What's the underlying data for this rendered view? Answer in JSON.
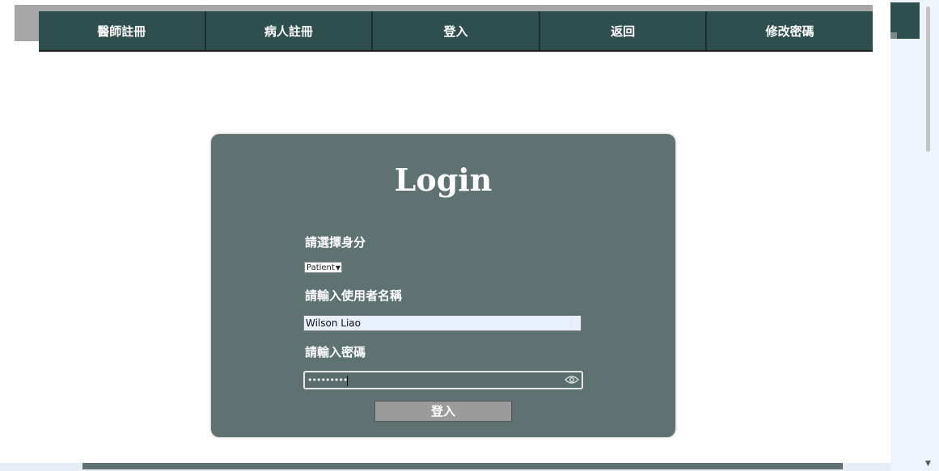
{
  "nav": {
    "items": [
      {
        "label": "醫師註冊"
      },
      {
        "label": "病人註冊"
      },
      {
        "label": "登入"
      },
      {
        "label": "返回"
      },
      {
        "label": "修改密碼"
      }
    ]
  },
  "login": {
    "title": "Login",
    "role_label": "請選擇身分",
    "role_selected": "Patient",
    "username_label": "請輸入使用者名稱",
    "username_value": "Wilson Liao",
    "password_label": "請輸入密碼",
    "password_value": "•••••••••",
    "submit_label": "登入"
  },
  "colors": {
    "nav_bg": "#2f4f4f",
    "card_bg": "#5d7271",
    "button_bg": "#9b9b9b"
  }
}
